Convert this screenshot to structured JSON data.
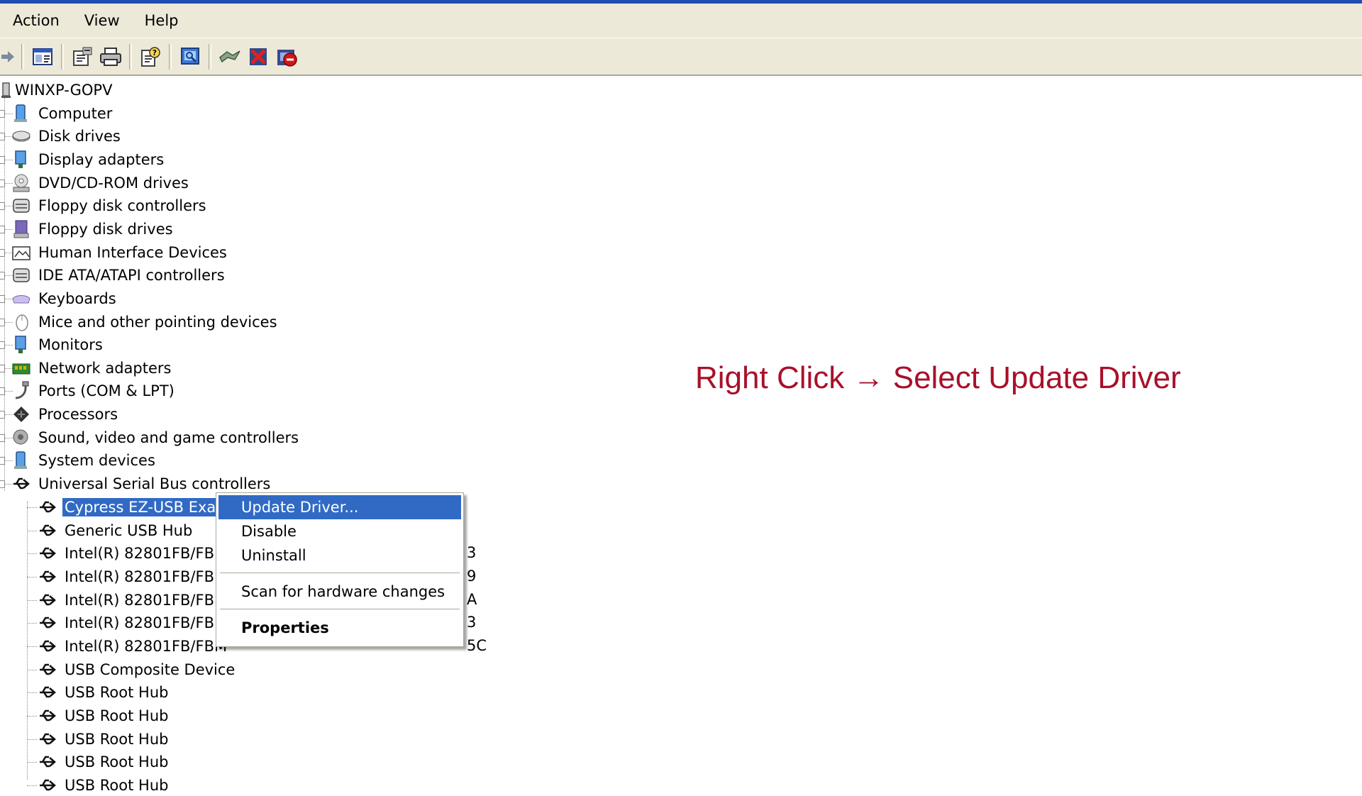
{
  "menubar": {
    "items": [
      "Action",
      "View",
      "Help"
    ]
  },
  "toolbar": {
    "icons": [
      "forward-arrow-icon",
      "show-hide-tree-icon",
      "properties-icon",
      "print-icon",
      "help-icon",
      "scan-hardware-icon",
      "update-driver-icon",
      "disable-device-icon",
      "uninstall-device-icon"
    ]
  },
  "tree": {
    "root": "WINXP-GOPV",
    "categories": [
      "Computer",
      "Disk drives",
      "Display adapters",
      "DVD/CD-ROM drives",
      "Floppy disk controllers",
      "Floppy disk drives",
      "Human Interface Devices",
      "IDE ATA/ATAPI controllers",
      "Keyboards",
      "Mice and other pointing devices",
      "Monitors",
      "Network adapters",
      "Ports (COM & LPT)",
      "Processors",
      "Sound, video and game controllers",
      "System devices",
      "Universal Serial Bus controllers"
    ],
    "usb_children": [
      "Cypress EZ-USB Exam",
      "Generic USB Hub",
      "Intel(R) 82801FB/FBM",
      "Intel(R) 82801FB/FBM",
      "Intel(R) 82801FB/FBM",
      "Intel(R) 82801FB/FBM",
      "Intel(R) 82801FB/FBM",
      "USB Composite Device",
      "USB Root Hub",
      "USB Root Hub",
      "USB Root Hub",
      "USB Root Hub",
      "USB Root Hub"
    ],
    "usb_trailing_fragments": [
      "3",
      "9",
      "A",
      "3",
      "5C"
    ]
  },
  "context_menu": {
    "update_driver": "Update Driver...",
    "disable": "Disable",
    "uninstall": "Uninstall",
    "scan": "Scan for hardware changes",
    "properties": "Properties"
  },
  "annotation": {
    "text": "Right Click → Select Update Driver"
  },
  "colors": {
    "selection": "#316ac5",
    "annotation": "#a8102a",
    "chrome": "#ece9d8"
  }
}
